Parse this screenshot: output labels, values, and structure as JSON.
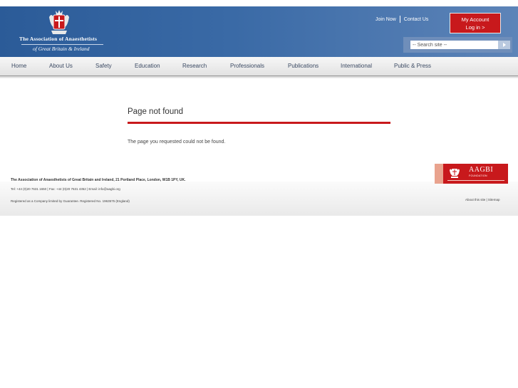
{
  "header": {
    "org_name_line1": "The Association of Anaesthetists",
    "org_name_line2": "of Great Britain & Ireland",
    "top_links": [
      "Join Now",
      "Contact Us"
    ],
    "my_account_label": "My Account",
    "login_label": "Log in >",
    "search_placeholder": "-- Search site --"
  },
  "nav": {
    "items": [
      "Home",
      "About Us",
      "Safety",
      "Education",
      "Research",
      "Professionals",
      "Publications",
      "International",
      "Public & Press"
    ]
  },
  "main": {
    "title": "Page not found",
    "message": "The page you requested could not be found."
  },
  "footer": {
    "address": "The Association of Anaesthetists of Great Britain and Ireland, 21 Portland Place, London, W1B 1PY, UK.",
    "contact": "Tel: +44 (0)20 7631 1650 | Fax: +44 (0)20 7631 4352 | Email: info@aagbi.org",
    "registration": "Registered as a Company limited by Guarantee. Registered No. 1963575 (England)",
    "links": "About this site | Sitemap",
    "foundation_title": "AAGBI",
    "foundation_sub": "FOUNDATION"
  },
  "colors": {
    "header_blue": "#2b5b98",
    "accent_red": "#c8191c",
    "nav_text": "#3b4a63"
  }
}
